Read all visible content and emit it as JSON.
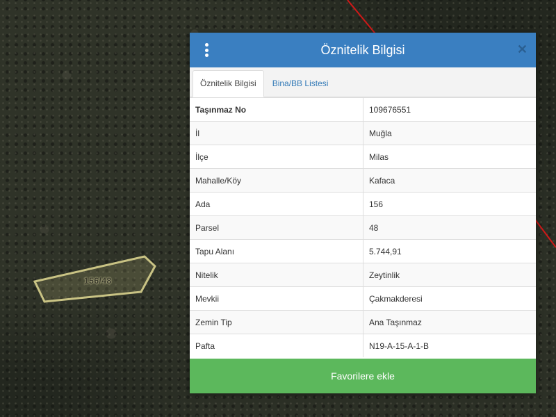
{
  "map": {
    "parcel_label": "156/48",
    "boundary_color": "#d01818",
    "parcel_color": "#c9c384"
  },
  "panel": {
    "title": "Öznitelik Bilgisi",
    "close_symbol": "✕",
    "tabs": [
      {
        "label": "Öznitelik Bilgisi",
        "active": true
      },
      {
        "label": "Bina/BB Listesi",
        "active": false
      }
    ],
    "rows": [
      {
        "key": "Taşınmaz No",
        "value": "109676551"
      },
      {
        "key": "İl",
        "value": "Muğla"
      },
      {
        "key": "İlçe",
        "value": "Milas"
      },
      {
        "key": "Mahalle/Köy",
        "value": "Kafaca"
      },
      {
        "key": "Ada",
        "value": "156"
      },
      {
        "key": "Parsel",
        "value": "48"
      },
      {
        "key": "Tapu Alanı",
        "value": "5.744,91"
      },
      {
        "key": "Nitelik",
        "value": "Zeytinlik"
      },
      {
        "key": "Mevkii",
        "value": "Çakmakderesi"
      },
      {
        "key": "Zemin Tip",
        "value": "Ana Taşınmaz"
      },
      {
        "key": "Pafta",
        "value": "N19-A-15-A-1-B"
      }
    ],
    "favorite_button_label": "Favorilere ekle",
    "header_color": "#3a7fc1",
    "button_color": "#5cb85c"
  }
}
